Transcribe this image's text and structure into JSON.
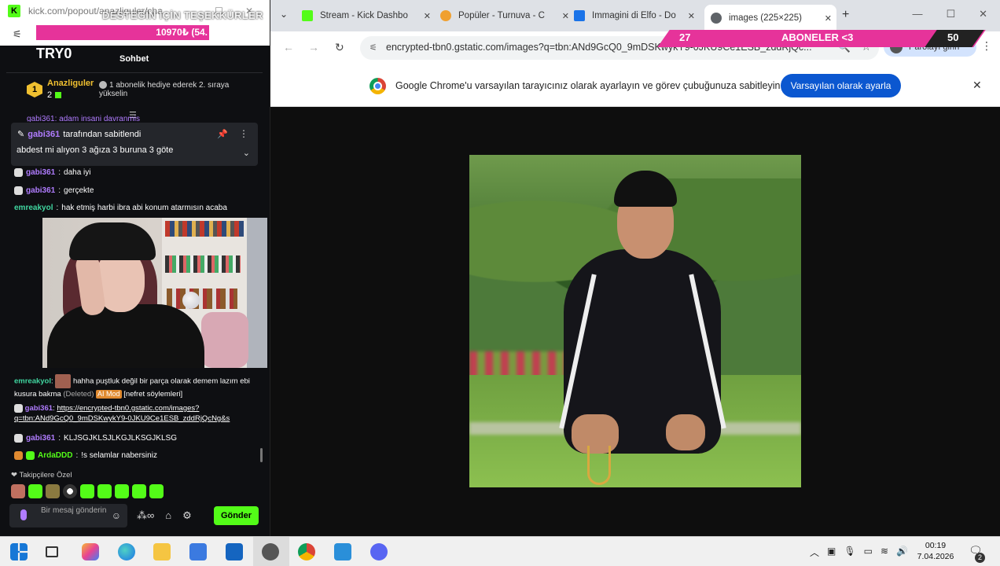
{
  "popout": {
    "url": "kick.com/popout/anazliguler/cha...",
    "overlay_thanks": "DESTEĞİN İÇİN TEŞEKKÜRLER",
    "donation_amount": "10970₺ (54.",
    "channel_name": "TRY0",
    "chat_tab": "Sohbet",
    "gift": {
      "user": "Anazliguler",
      "count": "2",
      "rank": "1",
      "message": "1 abonelik hediye ederek 2. sıraya yükselin"
    },
    "pinned": {
      "user": "gabi361",
      "by_text": "tarafından sabitlendi",
      "text": "abdest mi alıyon 3 ağıza 3 buruna 3 göte"
    },
    "clipped_line": "gabi361: adam insani davranmis",
    "messages": [
      {
        "user": "gabi361",
        "text": "daha iyi"
      },
      {
        "user": "gabi361",
        "text": "gerçekte"
      },
      {
        "user": "emreakyol",
        "text": "hak etmiş harbi ibra abi konum atarmısın acaba"
      }
    ],
    "mod_message": {
      "user": "emreakyol",
      "text": "hahha puştluk değil bir parça olarak demem lazım ebi kusura bakma",
      "deleted": "(Deleted)",
      "mod_tag": "AI Mod",
      "reason": "[nefret söylemleri]"
    },
    "link_message": {
      "user": "gabi361",
      "link": "https://encrypted-tbn0.gstatic.com/images?q=tbn:ANd9GcQ0_9mDSKwykY9-0JKU9Ce1ESB_zddRjQcNg&s"
    },
    "later_messages": [
      {
        "user": "gabi361",
        "text": "KLJSGJKLSJLKGJLKSGJKLSG"
      },
      {
        "user": "ArdaDDD",
        "text": "!s selamlar nabersiniz"
      }
    ],
    "followers_label": "Takipçilere Özel",
    "input_placeholder": "Bir mesaj gönderin",
    "send_label": "Gönder"
  },
  "chrome": {
    "tabs": [
      {
        "title": "Stream - Kick Dashbo",
        "color": "#53fc18"
      },
      {
        "title": "Popüler - Turnuva - C",
        "color": "#f0a030"
      },
      {
        "title": "Immagini di Elfo - Do",
        "color": "#1a73e8"
      },
      {
        "title": "images (225×225)",
        "color": "#5f6368",
        "active": true
      }
    ],
    "url": "encrypted-tbn0.gstatic.com/images?q=tbn:ANd9GcQ0_9mDSKwykY9-0JKU9Ce1ESB_zddRjQc...",
    "profile_label": "Parolayı girin",
    "sub_overlay": {
      "left": "27",
      "middle": "ABONELER <3",
      "right": "50"
    },
    "infobar_text": "Google Chrome'u varsayılan tarayıcınız olarak ayarlayın ve görev çubuğunuza sabitleyin",
    "infobar_button": "Varsayılan olarak ayarla"
  },
  "taskbar": {
    "time": "00:19",
    "date": "7.04.2026",
    "notifications": "2"
  }
}
